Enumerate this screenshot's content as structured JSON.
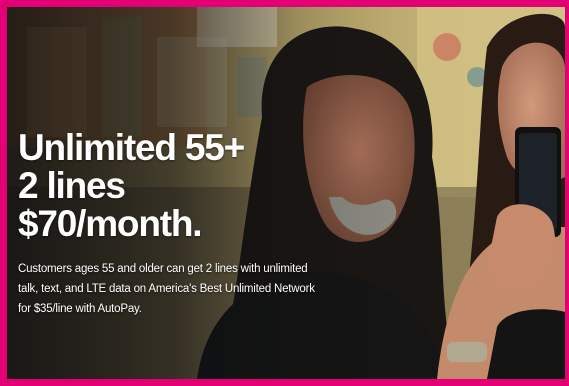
{
  "ad": {
    "headline": [
      "Unlimited 55+",
      "2 lines",
      "$70/month."
    ],
    "body_text": "Customers ages 55 and older can get 2 lines with unlimited talk, text, and LTE data on America's Best Unlimited Network for $35/line with AutoPay.",
    "image": "photo-two-people-looking-at-phone"
  },
  "colors": {
    "border": "#e20074",
    "text": "#ffffff"
  }
}
